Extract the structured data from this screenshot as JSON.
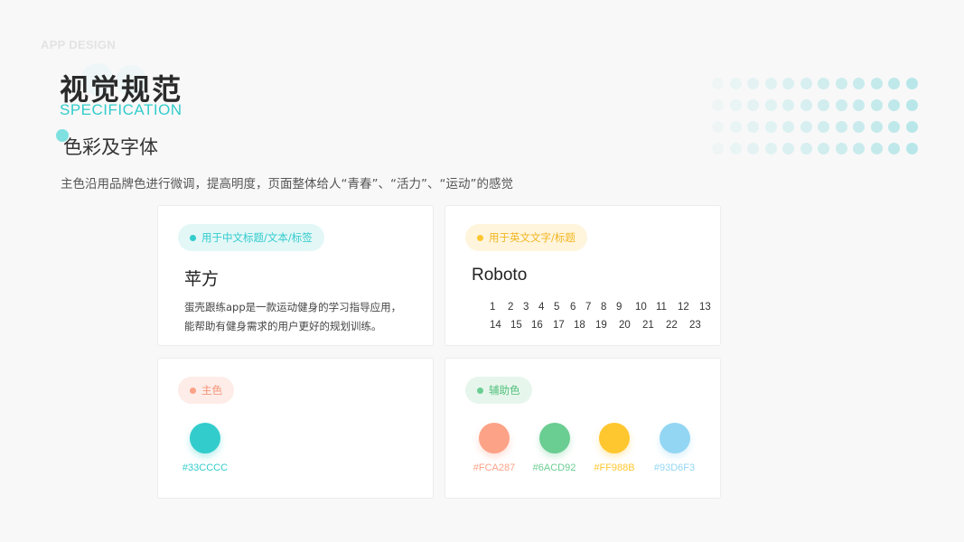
{
  "header": {
    "top_label": "APP DESIGN",
    "title": "视觉规范",
    "subtitle": "SPECIFICATION",
    "section_title": "色彩及字体",
    "description": "主色沿用品牌色进行微调，提高明度，页面整体给人“青春”、“活力”、“运动”的感觉"
  },
  "colors": {
    "primary": "#33CCCC",
    "accent_orange": "#FCA287",
    "accent_green": "#6ACD92",
    "accent_yellow": "#FF988B",
    "accent_blue": "#93D6F3"
  },
  "cards": {
    "chinese_font": {
      "tag": "用于中文标题/文本/标签",
      "font_name": "苹方",
      "sample": "蛋壳跟练app是一款运动健身的学习指导应用，能帮助有健身需求的用户更好的规划训练。"
    },
    "english_font": {
      "tag": "用于英文文字/标题",
      "font_name": "Roboto",
      "sizes_row1": [
        "1",
        "2",
        "3",
        "4",
        "5",
        "6",
        "7",
        "8",
        "9",
        "10",
        "11",
        "12",
        "13"
      ],
      "sizes_row2": [
        "14",
        "15",
        "16",
        "17",
        "18",
        "19",
        "20",
        "21",
        "22",
        "23"
      ]
    },
    "primary_color": {
      "tag": "主色",
      "swatches": [
        {
          "hex": "#33CCCC",
          "fill": "#33cccc"
        }
      ]
    },
    "secondary_color": {
      "tag": "辅助色",
      "swatches": [
        {
          "hex": "#FCA287",
          "fill": "#fca287"
        },
        {
          "hex": "#6ACD92",
          "fill": "#6acd92"
        },
        {
          "hex": "#FF988B",
          "fill": "#ffc72f"
        },
        {
          "hex": "#93D6F3",
          "fill": "#93d6f3"
        }
      ]
    }
  }
}
